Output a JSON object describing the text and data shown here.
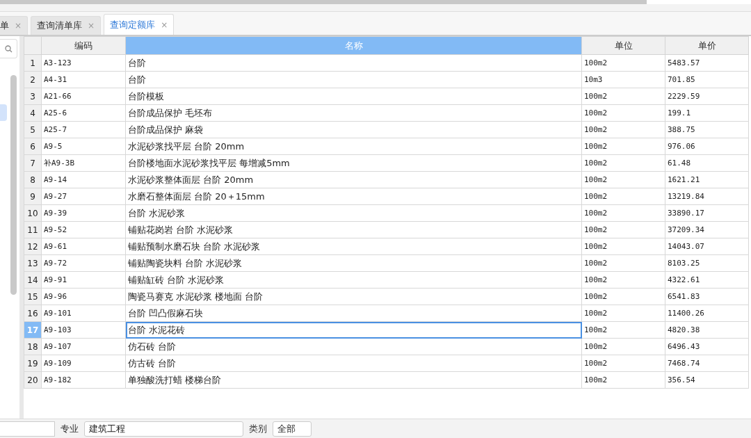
{
  "tabs": [
    {
      "label": "单",
      "selected": false,
      "close": "×"
    },
    {
      "label": "查询清单库",
      "selected": false,
      "close": "×"
    },
    {
      "label": "查询定额库",
      "selected": true,
      "close": "×"
    }
  ],
  "table": {
    "columns": [
      {
        "label": "编码",
        "selected": false
      },
      {
        "label": "名称",
        "selected": true
      },
      {
        "label": "单位",
        "selected": false
      },
      {
        "label": "单价",
        "selected": false
      }
    ],
    "rows": [
      {
        "num": "1",
        "code": "A3-123",
        "name": "台阶",
        "unit": "100m2",
        "price": "5483.57",
        "selected": false
      },
      {
        "num": "2",
        "code": "A4-31",
        "name": "台阶",
        "unit": "10m3",
        "price": "701.85",
        "selected": false
      },
      {
        "num": "3",
        "code": "A21-66",
        "name": "台阶模板",
        "unit": "100m2",
        "price": "2229.59",
        "selected": false
      },
      {
        "num": "4",
        "code": "A25-6",
        "name": "台阶成品保护 毛坯布",
        "unit": "100m2",
        "price": "199.1",
        "selected": false
      },
      {
        "num": "5",
        "code": "A25-7",
        "name": "台阶成品保护 麻袋",
        "unit": "100m2",
        "price": "388.75",
        "selected": false
      },
      {
        "num": "6",
        "code": "A9-5",
        "name": "水泥砂浆找平层 台阶 20mm",
        "unit": "100m2",
        "price": "976.06",
        "selected": false
      },
      {
        "num": "7",
        "code": "补A9-3B",
        "name": "台阶楼地面水泥砂浆找平层 每增减5mm",
        "unit": "100m2",
        "price": "61.48",
        "selected": false
      },
      {
        "num": "8",
        "code": "A9-14",
        "name": "水泥砂浆整体面层 台阶 20mm",
        "unit": "100m2",
        "price": "1621.21",
        "selected": false
      },
      {
        "num": "9",
        "code": "A9-27",
        "name": "水磨石整体面层 台阶 20＋15mm",
        "unit": "100m2",
        "price": "13219.84",
        "selected": false
      },
      {
        "num": "10",
        "code": "A9-39",
        "name": "台阶 水泥砂浆",
        "unit": "100m2",
        "price": "33890.17",
        "selected": false
      },
      {
        "num": "11",
        "code": "A9-52",
        "name": "铺贴花岗岩 台阶 水泥砂浆",
        "unit": "100m2",
        "price": "37209.34",
        "selected": false
      },
      {
        "num": "12",
        "code": "A9-61",
        "name": "铺贴预制水磨石块 台阶 水泥砂浆",
        "unit": "100m2",
        "price": "14043.07",
        "selected": false
      },
      {
        "num": "13",
        "code": "A9-72",
        "name": "铺贴陶瓷块料 台阶 水泥砂浆",
        "unit": "100m2",
        "price": "8103.25",
        "selected": false
      },
      {
        "num": "14",
        "code": "A9-91",
        "name": "铺贴缸砖 台阶 水泥砂浆",
        "unit": "100m2",
        "price": "4322.61",
        "selected": false
      },
      {
        "num": "15",
        "code": "A9-96",
        "name": "陶瓷马赛克 水泥砂浆 楼地面 台阶",
        "unit": "100m2",
        "price": "6541.83",
        "selected": false
      },
      {
        "num": "16",
        "code": "A9-101",
        "name": "台阶 凹凸假麻石块",
        "unit": "100m2",
        "price": "11400.26",
        "selected": false
      },
      {
        "num": "17",
        "code": "A9-103",
        "name": "台阶 水泥花砖",
        "unit": "100m2",
        "price": "4820.38",
        "selected": true
      },
      {
        "num": "18",
        "code": "A9-107",
        "name": "仿石砖 台阶",
        "unit": "100m2",
        "price": "6496.43",
        "selected": false
      },
      {
        "num": "19",
        "code": "A9-109",
        "name": "仿古砖 台阶",
        "unit": "100m2",
        "price": "7468.74",
        "selected": false
      },
      {
        "num": "20",
        "code": "A9-182",
        "name": "单独酸洗打蜡 楼梯台阶",
        "unit": "100m2",
        "price": "356.54",
        "selected": false
      }
    ]
  },
  "filters": {
    "major_label": "专业",
    "major_value": "建筑工程",
    "category_label": "类别",
    "category_value": "全部"
  }
}
